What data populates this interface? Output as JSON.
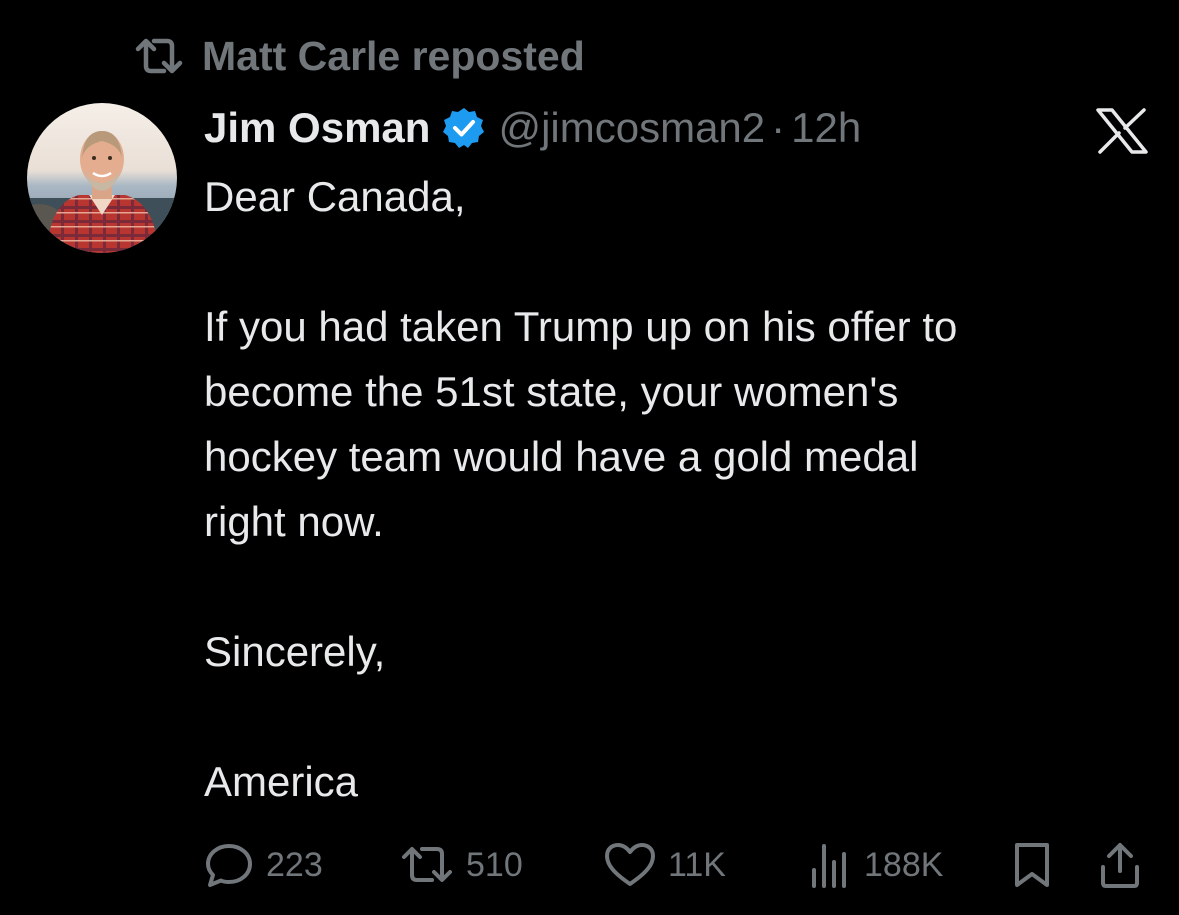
{
  "repost": {
    "icon": "repost-icon",
    "text": "Matt Carle reposted"
  },
  "author": {
    "display_name": "Jim Osman",
    "verified_icon": "verified-badge-icon",
    "handle": "@jimcosman2",
    "separator": "·",
    "time": "12h",
    "avatar": "avatar-photo"
  },
  "brand": {
    "logo": "x-logo-icon"
  },
  "tweet": {
    "lines": [
      "Dear Canada,",
      "",
      "If you had taken Trump up on his offer to",
      "become the 51st state, your women's",
      "hockey team would have a gold medal",
      "right now.",
      "",
      "Sincerely,",
      "",
      "America"
    ]
  },
  "actions": {
    "reply": {
      "icon": "reply-icon",
      "count": "223"
    },
    "repost": {
      "icon": "repost-icon",
      "count": "510"
    },
    "like": {
      "icon": "heart-icon",
      "count": "11K"
    },
    "views": {
      "icon": "views-chart-icon",
      "count": "188K"
    },
    "bookmark": {
      "icon": "bookmark-icon"
    },
    "share": {
      "icon": "share-icon"
    }
  },
  "colors": {
    "background": "#000000",
    "text": "#e7e9ea",
    "muted": "#71767b",
    "verified": "#1d9bf0"
  }
}
